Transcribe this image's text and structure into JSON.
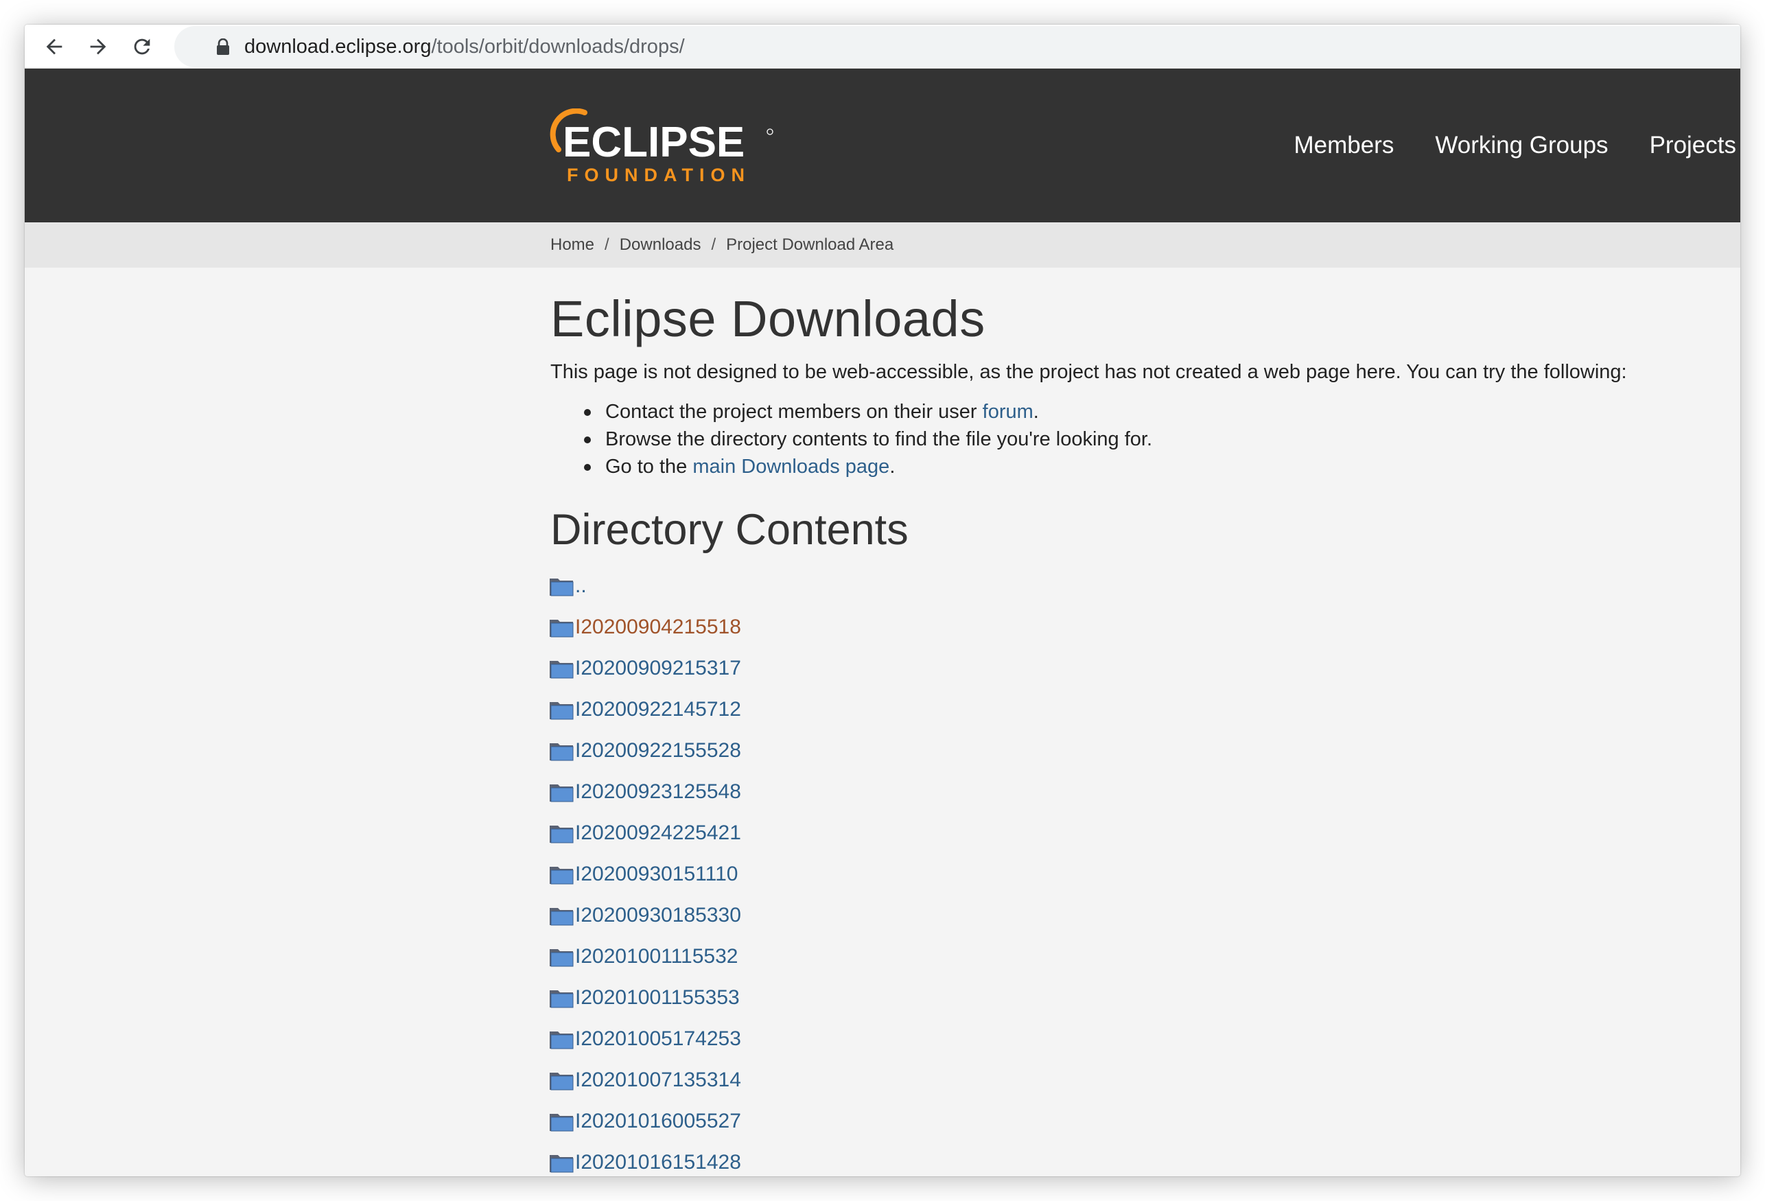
{
  "browser": {
    "url_domain": "download.eclipse.org",
    "url_path": "/tools/orbit/downloads/drops/"
  },
  "header": {
    "logo_top": "ECLIPSE",
    "logo_bottom": "FOUNDATION",
    "nav": [
      "Members",
      "Working Groups",
      "Projects"
    ],
    "colors": {
      "background": "#333333",
      "brand_orange": "#f7941e"
    }
  },
  "breadcrumb": [
    "Home",
    "Downloads",
    "Project Download Area"
  ],
  "main": {
    "title": "Eclipse Downloads",
    "intro": "This page is not designed to be web-accessible, as the project has not created a web page here. You can try the following:",
    "item1_text": "Contact the project members on their user ",
    "item1_link": "forum",
    "item1_end": ".",
    "item2_text": "Browse the directory contents to find the file you're looking for.",
    "item3_text": "Go to the ",
    "item3_link": "main Downloads page",
    "item3_end": ".",
    "directory_title": "Directory Contents",
    "directory": [
      "..",
      "I20200904215518",
      "I20200909215317",
      "I20200922145712",
      "I20200922155528",
      "I20200923125548",
      "I20200924225421",
      "I20200930151110",
      "I20200930185330",
      "I20201001115532",
      "I20201001155353",
      "I20201005174253",
      "I20201007135314",
      "I20201016005527",
      "I20201016151428"
    ],
    "link_color": "#2d5f8b",
    "visited_link_color": "#a0532a"
  }
}
